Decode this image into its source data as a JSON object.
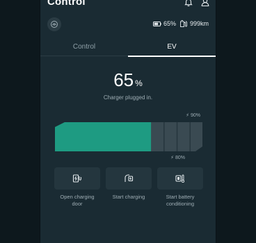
{
  "header": {
    "title": "Control",
    "icons": [
      "bell-icon",
      "user-icon"
    ]
  },
  "status": {
    "car_icon": "car-avatar-icon",
    "battery_icon": "battery-icon",
    "battery_percent": "65%",
    "range_icon": "range-icon",
    "range": "999km"
  },
  "tabs": [
    {
      "label": "Control",
      "active": false
    },
    {
      "label": "EV",
      "active": true
    }
  ],
  "charge": {
    "percent_value": "65",
    "percent_unit": "%",
    "status_text": "Charger plugged in.",
    "level": 0.65,
    "upper_limit": "90%",
    "lower_limit": "80%",
    "fill_color": "#1e9b82",
    "empty_color": "#3a4a52"
  },
  "actions": [
    {
      "label": "Open charging door",
      "icon": "charging-door-icon"
    },
    {
      "label": "Start charging",
      "icon": "start-charging-icon"
    },
    {
      "label": "Start battery conditioning",
      "icon": "battery-conditioning-icon"
    }
  ]
}
